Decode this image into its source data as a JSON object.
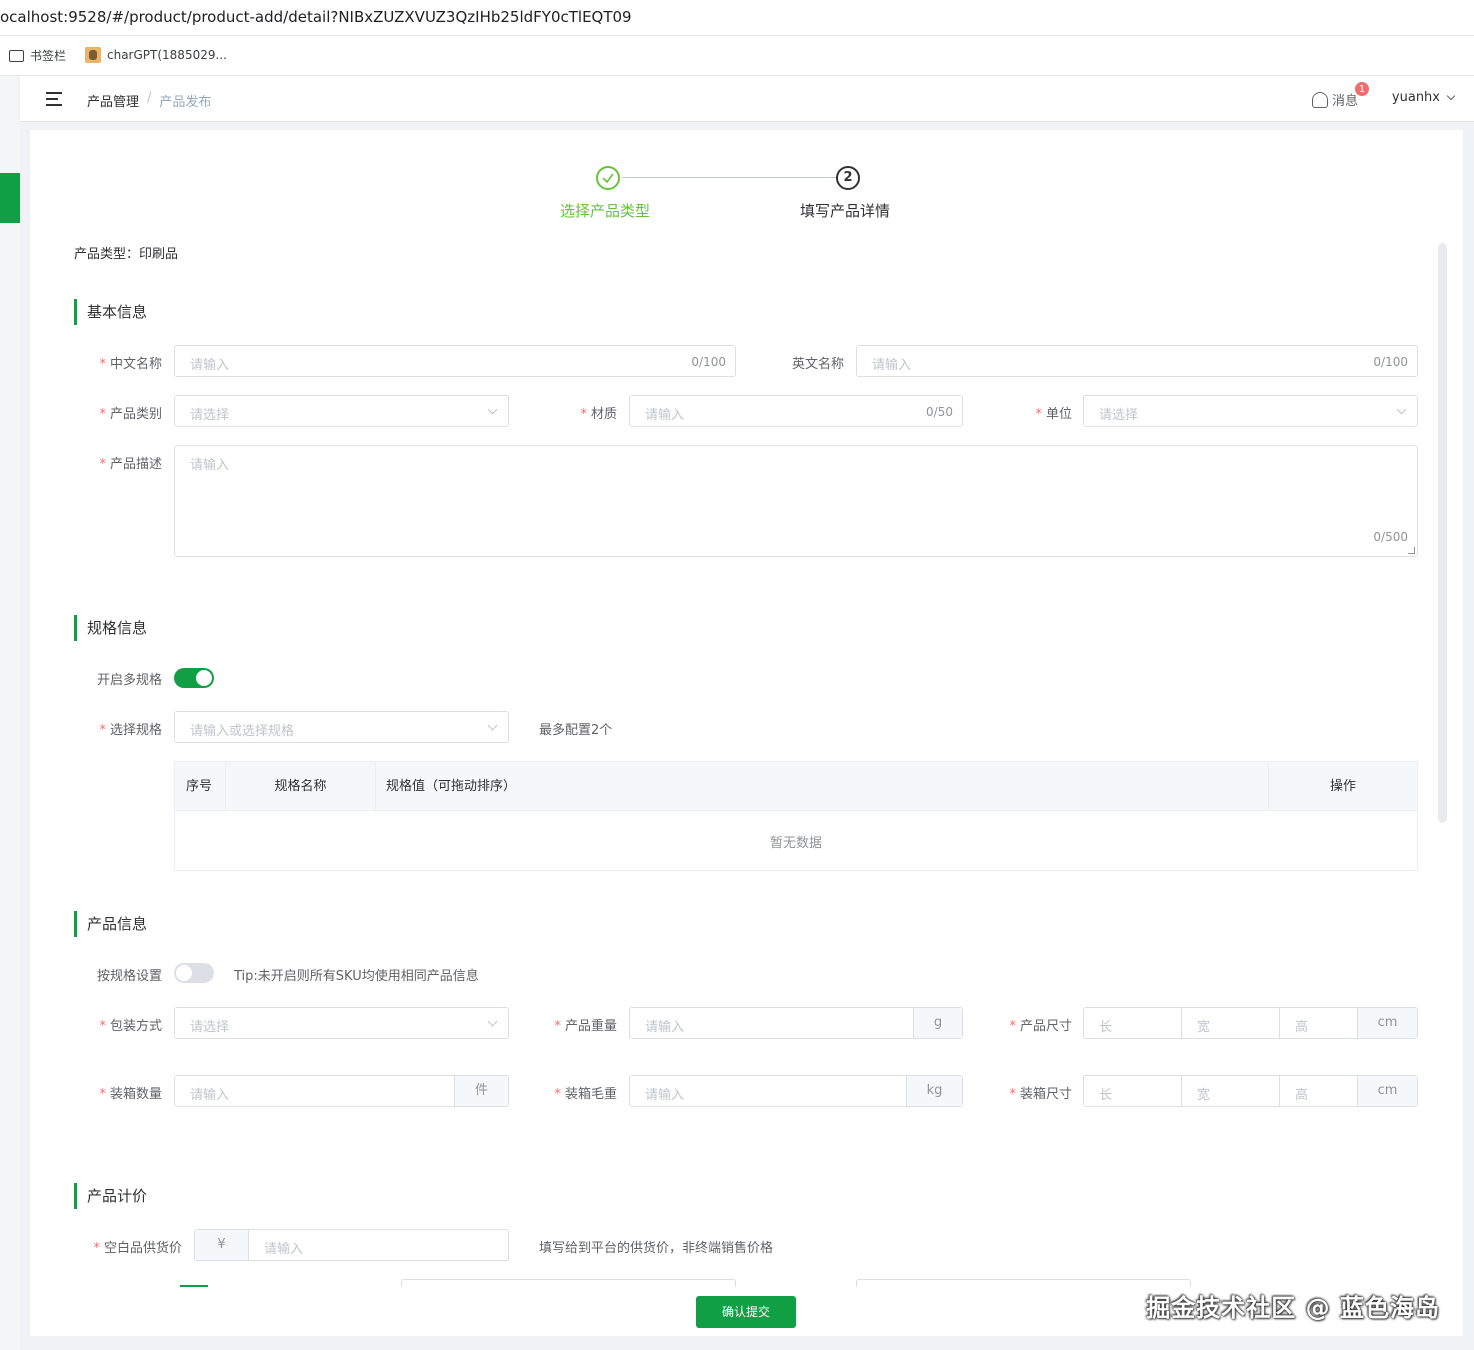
{
  "browser": {
    "url": "ocalhost:9528/#/product/product-add/detail?NIBxZUZXVUZ3QzIHb25ldFY0cTlEQT09",
    "bookmarks": [
      {
        "label": "书签栏",
        "icon": "folder-icon"
      },
      {
        "label": "charGPT(1885029...",
        "icon": "avatar-favicon"
      }
    ]
  },
  "navbar": {
    "breadcrumb": [
      "产品管理",
      "产品发布"
    ],
    "breadcrumb_sep": "/",
    "messages_label": "消息",
    "messages_badge": "1",
    "username": "yuanhx"
  },
  "steps": [
    {
      "title": "选择产品类型",
      "status": "finished",
      "icon": "check-icon"
    },
    {
      "title": "填写产品详情",
      "status": "current",
      "number": "2"
    }
  ],
  "product_type": "产品类型：印刷品",
  "basic": {
    "title": "基本信息",
    "cn_name": {
      "label": "中文名称",
      "placeholder": "请输入",
      "count": "0/100"
    },
    "en_name": {
      "label": "英文名称",
      "placeholder": "请输入",
      "count": "0/100"
    },
    "category": {
      "label": "产品类别",
      "placeholder": "请选择"
    },
    "material": {
      "label": "材质",
      "placeholder": "请输入",
      "count": "0/50"
    },
    "unit": {
      "label": "单位",
      "placeholder": "请选择"
    },
    "description": {
      "label": "产品描述",
      "placeholder": "请输入",
      "count": "0/500"
    }
  },
  "spec": {
    "title": "规格信息",
    "multi_label": "开启多规格",
    "multi_enabled": true,
    "select_label": "选择规格",
    "select_placeholder": "请输入或选择规格",
    "max_hint": "最多配置2个",
    "table_headers": [
      "序号",
      "规格名称",
      "规格值（可拖动排序）",
      "操作"
    ],
    "empty_text": "暂无数据"
  },
  "product_info": {
    "title": "产品信息",
    "by_spec_label": "按规格设置",
    "by_spec_enabled": false,
    "tip": "Tip:未开启则所有SKU均使用相同产品信息",
    "packing": {
      "label": "包装方式",
      "placeholder": "请选择"
    },
    "weight": {
      "label": "产品重量",
      "placeholder": "请输入",
      "unit": "g"
    },
    "size": {
      "label": "产品尺寸",
      "l": "长",
      "w": "宽",
      "h": "高",
      "unit": "cm"
    },
    "box_qty": {
      "label": "装箱数量",
      "placeholder": "请输入",
      "unit": "件"
    },
    "box_weight": {
      "label": "装箱毛重",
      "placeholder": "请输入",
      "unit": "kg"
    },
    "box_size": {
      "label": "装箱尺寸",
      "l": "长",
      "w": "宽",
      "h": "高",
      "unit": "cm"
    }
  },
  "pricing": {
    "title": "产品计价",
    "supply_label": "空白品供货价",
    "currency": "¥",
    "supply_placeholder": "请输入",
    "supply_hint": "填写给到平台的供货价，非终端销售价格"
  },
  "submit_label": "确认提交",
  "watermark": "掘金技术社区 @ 蓝色海岛",
  "colors": {
    "primary": "#119f45",
    "success": "#67c23a",
    "danger": "#f56c6c"
  }
}
